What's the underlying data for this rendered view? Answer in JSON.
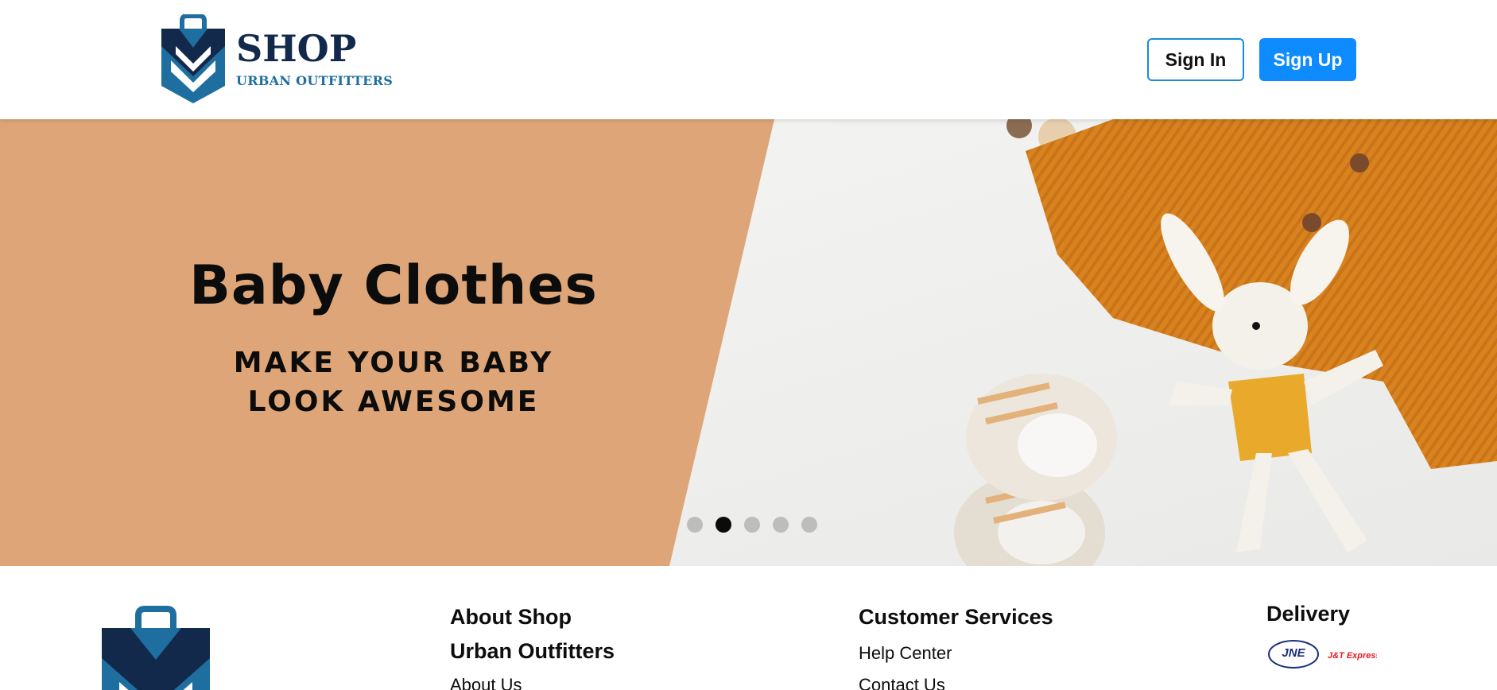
{
  "header": {
    "logo_title": "SHOP",
    "logo_subtitle": "URBAN OUTFITTERS",
    "signin_label": "Sign In",
    "signup_label": "Sign Up"
  },
  "hero": {
    "title": "Baby Clothes",
    "subtitle_line1": "MAKE YOUR BABY",
    "subtitle_line2": "LOOK AWESOME",
    "slide_count": 5,
    "active_slide": 2
  },
  "footer": {
    "about_title_line1": "About Shop",
    "about_title_line2": "Urban Outfitters",
    "about_link": "About Us",
    "services_title": "Customer Services",
    "services_links": [
      "Help Center",
      "Contact Us"
    ],
    "delivery_title": "Delivery",
    "delivery_partners": [
      "JNE",
      "J&T Express"
    ]
  },
  "colors": {
    "brand_navy": "#13294b",
    "brand_blue": "#1e6e9f",
    "accent_button": "#0d8bff",
    "banner_tan": "#dea678",
    "slider_active": "#0b0b0b",
    "slider_inactive": "#bdbdbd"
  }
}
